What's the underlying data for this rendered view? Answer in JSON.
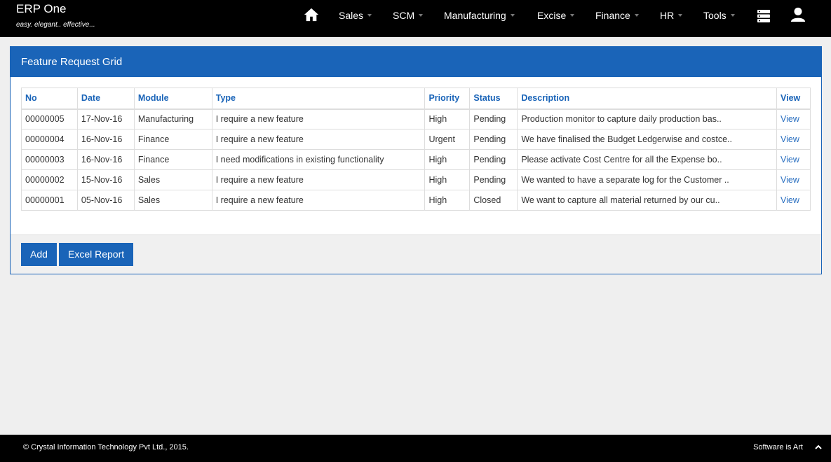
{
  "brand": {
    "title": "ERP One",
    "tagline": "easy. elegant.. effective..."
  },
  "nav": {
    "items": [
      "Sales",
      "SCM",
      "Manufacturing",
      "Excise",
      "Finance",
      "HR",
      "Tools"
    ]
  },
  "panel": {
    "title": "Feature Request Grid",
    "columns": [
      "No",
      "Date",
      "Module",
      "Type",
      "Priority",
      "Status",
      "Description",
      "View"
    ],
    "rows": [
      [
        "00000005",
        "17-Nov-16",
        "Manufacturing",
        "I require a new feature",
        "High",
        "Pending",
        "Production monitor to capture daily production bas..",
        "View"
      ],
      [
        "00000004",
        "16-Nov-16",
        "Finance",
        "I require a new feature",
        "Urgent",
        "Pending",
        "We have finalised the Budget Ledgerwise and costce..",
        "View"
      ],
      [
        "00000003",
        "16-Nov-16",
        "Finance",
        "I need modifications in existing functionality",
        "High",
        "Pending",
        "Please activate Cost Centre for all the Expense bo..",
        "View"
      ],
      [
        "00000002",
        "15-Nov-16",
        "Sales",
        "I require a new feature",
        "High",
        "Pending",
        "We wanted to have a separate log for the Customer ..",
        "View"
      ],
      [
        "00000001",
        "05-Nov-16",
        "Sales",
        "I require a new feature",
        "High",
        "Closed",
        "We want to capture all material returned by our cu..",
        "View"
      ]
    ],
    "buttons": {
      "add": "Add",
      "excel": "Excel Report"
    }
  },
  "footer": {
    "copyright": "© Crystal Information Technology Pvt Ltd., 2015.",
    "tagline": "Software is Art"
  },
  "colors": {
    "accent": "#1a64b8",
    "navbar": "#000000",
    "background": "#efefef"
  }
}
